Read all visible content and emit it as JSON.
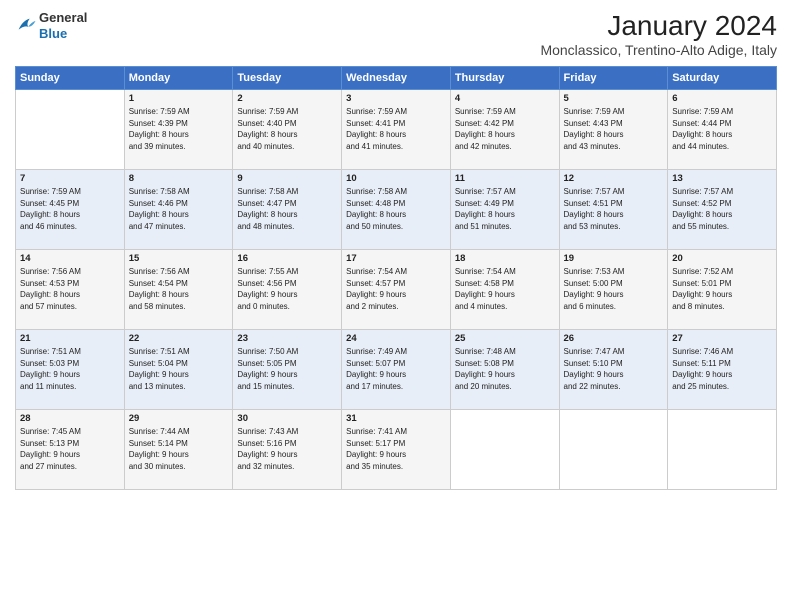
{
  "header": {
    "logo": {
      "line1": "General",
      "line2": "Blue"
    },
    "title": "January 2024",
    "location": "Monclassico, Trentino-Alto Adige, Italy"
  },
  "weekdays": [
    "Sunday",
    "Monday",
    "Tuesday",
    "Wednesday",
    "Thursday",
    "Friday",
    "Saturday"
  ],
  "weeks": [
    [
      {
        "day": "",
        "text": ""
      },
      {
        "day": "1",
        "text": "Sunrise: 7:59 AM\nSunset: 4:39 PM\nDaylight: 8 hours\nand 39 minutes."
      },
      {
        "day": "2",
        "text": "Sunrise: 7:59 AM\nSunset: 4:40 PM\nDaylight: 8 hours\nand 40 minutes."
      },
      {
        "day": "3",
        "text": "Sunrise: 7:59 AM\nSunset: 4:41 PM\nDaylight: 8 hours\nand 41 minutes."
      },
      {
        "day": "4",
        "text": "Sunrise: 7:59 AM\nSunset: 4:42 PM\nDaylight: 8 hours\nand 42 minutes."
      },
      {
        "day": "5",
        "text": "Sunrise: 7:59 AM\nSunset: 4:43 PM\nDaylight: 8 hours\nand 43 minutes."
      },
      {
        "day": "6",
        "text": "Sunrise: 7:59 AM\nSunset: 4:44 PM\nDaylight: 8 hours\nand 44 minutes."
      }
    ],
    [
      {
        "day": "7",
        "text": "Sunrise: 7:59 AM\nSunset: 4:45 PM\nDaylight: 8 hours\nand 46 minutes."
      },
      {
        "day": "8",
        "text": "Sunrise: 7:58 AM\nSunset: 4:46 PM\nDaylight: 8 hours\nand 47 minutes."
      },
      {
        "day": "9",
        "text": "Sunrise: 7:58 AM\nSunset: 4:47 PM\nDaylight: 8 hours\nand 48 minutes."
      },
      {
        "day": "10",
        "text": "Sunrise: 7:58 AM\nSunset: 4:48 PM\nDaylight: 8 hours\nand 50 minutes."
      },
      {
        "day": "11",
        "text": "Sunrise: 7:57 AM\nSunset: 4:49 PM\nDaylight: 8 hours\nand 51 minutes."
      },
      {
        "day": "12",
        "text": "Sunrise: 7:57 AM\nSunset: 4:51 PM\nDaylight: 8 hours\nand 53 minutes."
      },
      {
        "day": "13",
        "text": "Sunrise: 7:57 AM\nSunset: 4:52 PM\nDaylight: 8 hours\nand 55 minutes."
      }
    ],
    [
      {
        "day": "14",
        "text": "Sunrise: 7:56 AM\nSunset: 4:53 PM\nDaylight: 8 hours\nand 57 minutes."
      },
      {
        "day": "15",
        "text": "Sunrise: 7:56 AM\nSunset: 4:54 PM\nDaylight: 8 hours\nand 58 minutes."
      },
      {
        "day": "16",
        "text": "Sunrise: 7:55 AM\nSunset: 4:56 PM\nDaylight: 9 hours\nand 0 minutes."
      },
      {
        "day": "17",
        "text": "Sunrise: 7:54 AM\nSunset: 4:57 PM\nDaylight: 9 hours\nand 2 minutes."
      },
      {
        "day": "18",
        "text": "Sunrise: 7:54 AM\nSunset: 4:58 PM\nDaylight: 9 hours\nand 4 minutes."
      },
      {
        "day": "19",
        "text": "Sunrise: 7:53 AM\nSunset: 5:00 PM\nDaylight: 9 hours\nand 6 minutes."
      },
      {
        "day": "20",
        "text": "Sunrise: 7:52 AM\nSunset: 5:01 PM\nDaylight: 9 hours\nand 8 minutes."
      }
    ],
    [
      {
        "day": "21",
        "text": "Sunrise: 7:51 AM\nSunset: 5:03 PM\nDaylight: 9 hours\nand 11 minutes."
      },
      {
        "day": "22",
        "text": "Sunrise: 7:51 AM\nSunset: 5:04 PM\nDaylight: 9 hours\nand 13 minutes."
      },
      {
        "day": "23",
        "text": "Sunrise: 7:50 AM\nSunset: 5:05 PM\nDaylight: 9 hours\nand 15 minutes."
      },
      {
        "day": "24",
        "text": "Sunrise: 7:49 AM\nSunset: 5:07 PM\nDaylight: 9 hours\nand 17 minutes."
      },
      {
        "day": "25",
        "text": "Sunrise: 7:48 AM\nSunset: 5:08 PM\nDaylight: 9 hours\nand 20 minutes."
      },
      {
        "day": "26",
        "text": "Sunrise: 7:47 AM\nSunset: 5:10 PM\nDaylight: 9 hours\nand 22 minutes."
      },
      {
        "day": "27",
        "text": "Sunrise: 7:46 AM\nSunset: 5:11 PM\nDaylight: 9 hours\nand 25 minutes."
      }
    ],
    [
      {
        "day": "28",
        "text": "Sunrise: 7:45 AM\nSunset: 5:13 PM\nDaylight: 9 hours\nand 27 minutes."
      },
      {
        "day": "29",
        "text": "Sunrise: 7:44 AM\nSunset: 5:14 PM\nDaylight: 9 hours\nand 30 minutes."
      },
      {
        "day": "30",
        "text": "Sunrise: 7:43 AM\nSunset: 5:16 PM\nDaylight: 9 hours\nand 32 minutes."
      },
      {
        "day": "31",
        "text": "Sunrise: 7:41 AM\nSunset: 5:17 PM\nDaylight: 9 hours\nand 35 minutes."
      },
      {
        "day": "",
        "text": ""
      },
      {
        "day": "",
        "text": ""
      },
      {
        "day": "",
        "text": ""
      }
    ]
  ]
}
